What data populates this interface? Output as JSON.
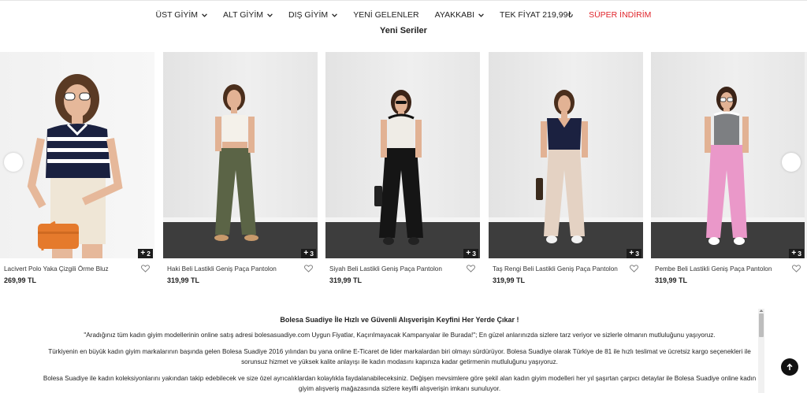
{
  "nav": {
    "items": [
      {
        "label": "ÜST GİYİM",
        "dropdown": true,
        "color": "#222222"
      },
      {
        "label": "ALT GİYİM",
        "dropdown": true,
        "color": "#222222"
      },
      {
        "label": "DIŞ GİYİM",
        "dropdown": true,
        "color": "#222222"
      },
      {
        "label": "YENİ GELENLER",
        "dropdown": false,
        "color": "#222222"
      },
      {
        "label": "AYAKKABI",
        "dropdown": true,
        "color": "#222222"
      },
      {
        "label": "TEK FİYAT 219,99₺",
        "dropdown": false,
        "color": "#222222"
      },
      {
        "label": "SÜPER İNDİRİM",
        "dropdown": false,
        "color": "#e0242b"
      }
    ]
  },
  "section_title": "Yeni Seriler",
  "products": [
    {
      "name": "Lacivert Polo Yaka Çizgili Örme Bluz",
      "price": "269,99 TL",
      "extra_images": "2",
      "top_color": "#1a2140",
      "bottom_color": "#efe6d6",
      "accent": "#e57a2c"
    },
    {
      "name": "Haki Beli Lastikli Geniş Paça Pantolon",
      "price": "319,99 TL",
      "extra_images": "3",
      "top_color": "#f4f1ea",
      "bottom_color": "#5b6446",
      "accent": "#c89a6b"
    },
    {
      "name": "Siyah Beli Lastikli Geniş Paça Pantolon",
      "price": "319,99 TL",
      "extra_images": "3",
      "top_color": "#efece6",
      "bottom_color": "#151515",
      "accent": "#222222"
    },
    {
      "name": "Taş Rengi Beli Lastikli Geniş Paça Pantolon",
      "price": "319,99 TL",
      "extra_images": "3",
      "top_color": "#1b2140",
      "bottom_color": "#e4d2c3",
      "accent": "#3a2a1c"
    },
    {
      "name": "Pembe Beli Lastikli Geniş Paça Pantolon",
      "price": "319,99 TL",
      "extra_images": "3",
      "top_color": "#7d7f82",
      "bottom_color": "#ea98c9",
      "accent": "#ffffff"
    }
  ],
  "seo": {
    "heading": "Bolesa Suadiye İle Hızlı ve Güvenli Alışverişin Keyfini Her Yerde Çıkar !",
    "paragraphs": [
      "\"Aradığınız tüm kadın giyim modellerinin online satış adresi bolesasuadiye.com Uygun Fiyatlar, Kaçırılmayacak Kampanyalar ile Burada!\"; En güzel anlarınızda sizlere tarz veriyor ve sizlerle olmanın mutluluğunu yaşıyoruz.",
      "Türkiyenin en büyük kadın giyim markalarının başında gelen Bolesa Suadiye 2016 yılından bu yana online E-Ticaret de lider markalardan biri olmayı sürdürüyor. Bolesa Suadiye olarak Türkiye de 81 ile hızlı teslimat ve ücretsiz kargo seçenekleri ile sorunsuz hizmet ve yüksek kalite anlayışı ile kadın modasını kapınıza kadar getirmenin mutluluğunu yaşıyoruz.",
      "Bolesa Suadiye ile kadın koleksiyonlarını yakından takip edebilecek ve size özel ayrıcalıklardan kolaylıkla faydalanabileceksiniz. Değişen mevsimlere göre şekil alan kadın giyim modelleri her yıl şaşırtan çarpıcı detaylar ile Bolesa Suadiye online kadın giyim alışveriş mağazasında sizlere keyifli alışverişin imkanı sunuluyor."
    ]
  }
}
